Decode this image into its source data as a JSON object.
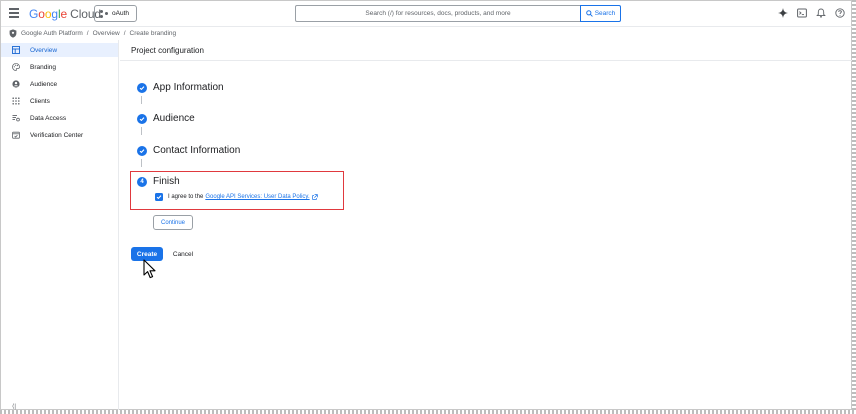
{
  "header": {
    "logo_letters": [
      "G",
      "o",
      "o",
      "g",
      "l",
      "e"
    ],
    "logo_product": "Cloud",
    "project": "oAuth",
    "search_placeholder": "Search (/) for resources, docs, products, and more",
    "search_button": "Search",
    "icons": [
      "gemini-spark-icon",
      "cloud-shell-icon",
      "notifications-bell-icon",
      "help-icon"
    ]
  },
  "breadcrumb": [
    "Google Auth Platform",
    "Overview",
    "Create branding"
  ],
  "sidebar": {
    "items": [
      {
        "label": "Overview",
        "icon": "dashboard-grid-icon",
        "active": true
      },
      {
        "label": "Branding",
        "icon": "palette-icon",
        "active": false
      },
      {
        "label": "Audience",
        "icon": "person-circle-icon",
        "active": false
      },
      {
        "label": "Clients",
        "icon": "apps-grid-icon",
        "active": false
      },
      {
        "label": "Data Access",
        "icon": "data-access-icon",
        "active": false
      },
      {
        "label": "Verification Center",
        "icon": "verification-icon",
        "active": false
      }
    ],
    "collapse_label": "⟨|"
  },
  "main": {
    "title": "Project configuration",
    "steps": [
      {
        "title": "App Information",
        "status": "complete"
      },
      {
        "title": "Audience",
        "status": "complete"
      },
      {
        "title": "Contact Information",
        "status": "complete"
      },
      {
        "title": "Finish",
        "status": "current",
        "number": "4"
      }
    ],
    "agree_text": "I agree to the",
    "agree_link": "Google API Services: User Data Policy.",
    "agree_checked": true,
    "continue_label": "Continue",
    "create_label": "Create",
    "cancel_label": "Cancel"
  },
  "colors": {
    "accent": "#1a73e8",
    "highlight_border": "#e0393e",
    "active_nav_bg": "#e8f0fe"
  }
}
